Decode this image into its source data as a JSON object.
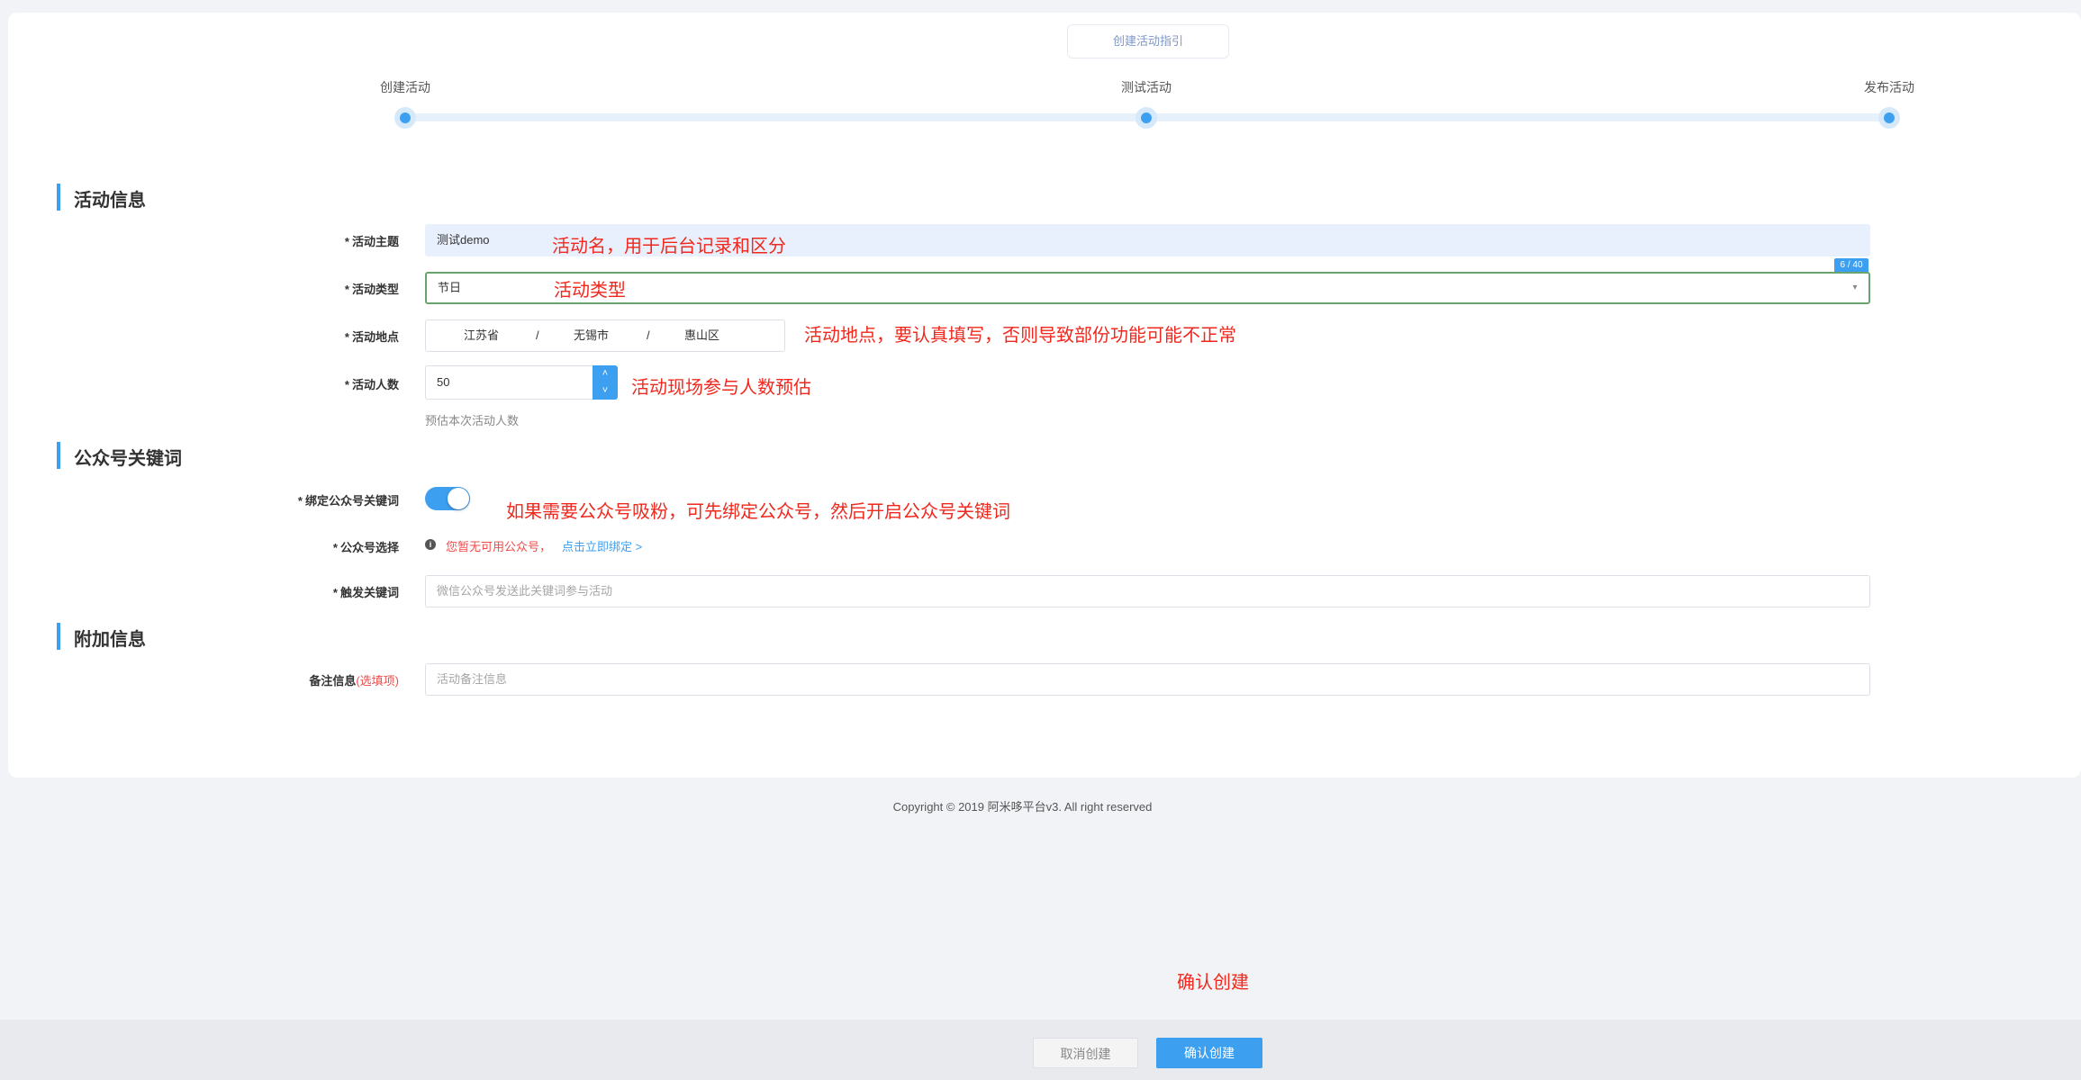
{
  "guide_button": "创建活动指引",
  "steps": [
    "创建活动",
    "测试活动",
    "发布活动"
  ],
  "sections": {
    "activity_info": "活动信息",
    "wechat_keywords": "公众号关键词",
    "extra_info": "附加信息"
  },
  "fields": {
    "theme": {
      "label": "活动主题",
      "value": "测试demo",
      "counter": "6 / 40"
    },
    "type": {
      "label": "活动类型",
      "value": "节日"
    },
    "location": {
      "label": "活动地点",
      "province": "江苏省",
      "city": "无锡市",
      "district": "惠山区",
      "separator": "/"
    },
    "count": {
      "label": "活动人数",
      "value": "50",
      "hint": "预估本次活动人数"
    },
    "bind_keyword": {
      "label": "绑定公众号关键词",
      "enabled": true
    },
    "account_select": {
      "label": "公众号选择",
      "warning": "您暂无可用公众号，",
      "link": "点击立即绑定 >"
    },
    "trigger_keyword": {
      "label": "触发关键词",
      "placeholder": "微信公众号发送此关键词参与活动"
    },
    "remark": {
      "label": "备注信息",
      "optional": "(选填项)",
      "placeholder": "活动备注信息"
    }
  },
  "required_mark": "*",
  "annotations": {
    "theme": "活动名，用于后台记录和区分",
    "type": "活动类型",
    "location": "活动地点，要认真填写，否则导致部份功能可能不正常",
    "count": "活动现场参与人数预估",
    "bind": "如果需要公众号吸粉，可先绑定公众号，然后开启公众号关键词",
    "confirm": "确认创建"
  },
  "footer": "Copyright © 2019 阿米哆平台v3. All right reserved",
  "buttons": {
    "cancel": "取消创建",
    "confirm": "确认创建"
  },
  "colors": {
    "accent": "#3d9ff0",
    "annotation": "#f0281e",
    "warning": "#f04b4b"
  }
}
